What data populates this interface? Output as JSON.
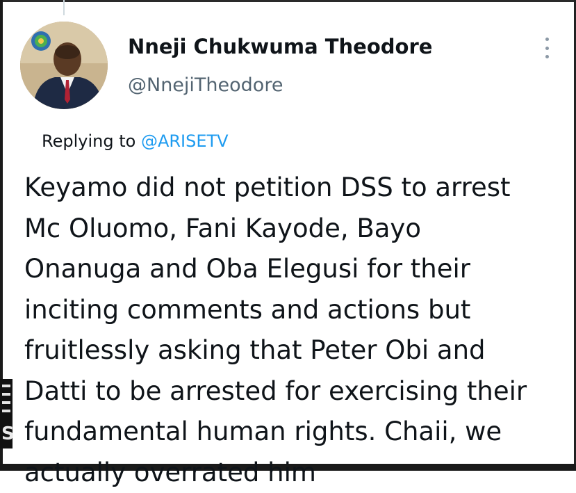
{
  "tweet": {
    "display_name": "Nneji Chukwuma Theodore",
    "handle": "@NnejiTheodore",
    "replying_prefix": "Replying to",
    "replying_to": "@ARISETV",
    "text": "Keyamo did not petition DSS to arrest\nMc Oluomo, Fani Kayode, Bayo\nOnanuga and Oba Elegusi for their\ninciting comments and actions  but\nfruitlessly asking that Peter Obi and\nDatti to be arrested for exercising their\nfundamental human rights. Chaii, we\nactually overrated him"
  },
  "icons": {
    "avatar": "profile-photo",
    "more": "more-options-vertical-icon"
  },
  "side_artifact": {
    "letter": "S"
  },
  "colors": {
    "text": "#0f1419",
    "secondary": "#536471",
    "link": "#1d9bf0",
    "background": "#ffffff"
  }
}
